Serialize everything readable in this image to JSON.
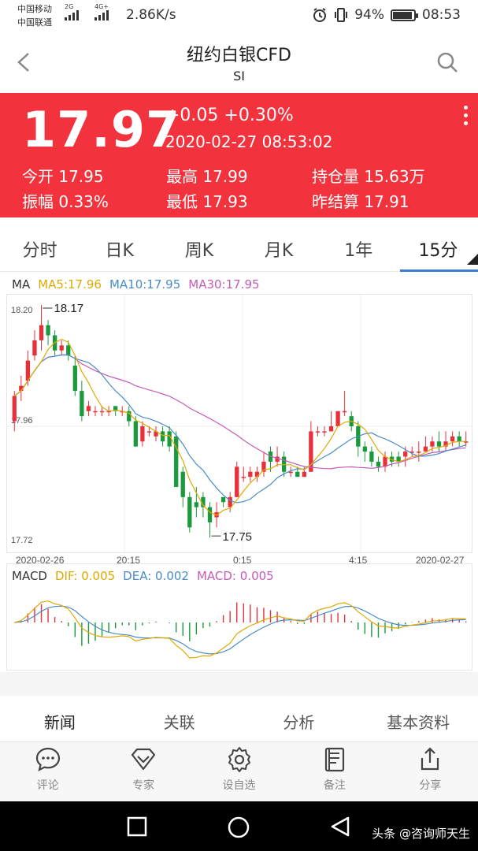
{
  "status_bar": {
    "carrier1": "中国移动",
    "carrier2": "中国联通",
    "net1": "2G",
    "net2": "4G+",
    "speed": "2.86K/s",
    "battery": "94%",
    "battery_level": 0.94,
    "time": "08:53"
  },
  "header": {
    "title": "纽约白银CFD",
    "subtitle": "SI"
  },
  "quote": {
    "price": "17.97",
    "change": "+0.05  +0.30%",
    "datetime": "2020-02-27  08:53:02",
    "rows": [
      [
        "今开 17.95",
        "最高 17.99",
        "持仓量 15.63万"
      ],
      [
        "振幅 0.33%",
        "最低 17.93",
        "昨结算 17.91"
      ]
    ],
    "colors": {
      "background": "#f2333d",
      "text": "#ffffff"
    }
  },
  "tabs": [
    {
      "label": "分时",
      "active": false
    },
    {
      "label": "日K",
      "active": false
    },
    {
      "label": "周K",
      "active": false
    },
    {
      "label": "月K",
      "active": false
    },
    {
      "label": "1年",
      "active": false
    },
    {
      "label": "15分",
      "active": true
    }
  ],
  "chart_data": {
    "type": "candlestick",
    "ma_legend": {
      "label": "MA",
      "ma5": "MA5:17.96",
      "ma10": "MA10:17.95",
      "ma30": "MA30:17.95"
    },
    "y_ticks": [
      "18.20",
      "17.96",
      "17.72"
    ],
    "ylim": [
      17.72,
      18.2
    ],
    "max_label": "18.17",
    "min_label": "17.75",
    "x_ticks": [
      "2020-02-26",
      "20:15",
      "0:15",
      "4:15",
      "2020-02-27"
    ],
    "colors": {
      "up": "#e8303a",
      "down": "#1a9a3c",
      "ma5": "#e0a800",
      "ma10": "#4a8cc8",
      "ma30": "#c45bb8"
    },
    "candles": [
      [
        17.97,
        18.02,
        18.03,
        17.95
      ],
      [
        18.03,
        18.04,
        18.06,
        18.01
      ],
      [
        18.05,
        18.09,
        18.11,
        18.04
      ],
      [
        18.1,
        18.13,
        18.15,
        18.09
      ],
      [
        18.13,
        18.16,
        18.2,
        18.11
      ],
      [
        18.16,
        18.14,
        18.17,
        18.12
      ],
      [
        18.14,
        18.11,
        18.15,
        18.1
      ],
      [
        18.11,
        18.12,
        18.13,
        18.1
      ],
      [
        18.12,
        18.1,
        18.13,
        18.09
      ],
      [
        18.08,
        18.03,
        18.1,
        18.02
      ],
      [
        18.03,
        17.98,
        18.05,
        17.97
      ],
      [
        17.99,
        18.0,
        18.01,
        17.98
      ],
      [
        17.99,
        17.99,
        18.0,
        17.98
      ],
      [
        17.99,
        17.99,
        18.0,
        17.98
      ],
      [
        17.99,
        17.99,
        18.0,
        17.98
      ],
      [
        18.0,
        17.99,
        18.0,
        17.98
      ],
      [
        17.99,
        17.99,
        18.0,
        17.98
      ],
      [
        17.99,
        17.97,
        18.0,
        17.96
      ],
      [
        17.97,
        17.92,
        17.98,
        17.92
      ],
      [
        17.93,
        17.96,
        17.97,
        17.92
      ],
      [
        17.95,
        17.95,
        17.96,
        17.94
      ],
      [
        17.94,
        17.95,
        17.96,
        17.93
      ],
      [
        17.95,
        17.93,
        17.96,
        17.92
      ],
      [
        17.95,
        17.92,
        17.96,
        17.91
      ],
      [
        17.94,
        17.84,
        17.95,
        17.84
      ],
      [
        17.87,
        17.82,
        17.88,
        17.8
      ],
      [
        17.82,
        17.76,
        17.83,
        17.75
      ],
      [
        17.81,
        17.8,
        17.84,
        17.78
      ],
      [
        17.82,
        17.8,
        17.83,
        17.78
      ],
      [
        17.8,
        17.77,
        17.81,
        17.74
      ],
      [
        17.78,
        17.79,
        17.81,
        17.76
      ],
      [
        17.82,
        17.81,
        17.82,
        17.8
      ],
      [
        17.8,
        17.82,
        17.83,
        17.79
      ],
      [
        17.82,
        17.88,
        17.89,
        17.82
      ],
      [
        17.86,
        17.86,
        17.88,
        17.85
      ],
      [
        17.86,
        17.87,
        17.88,
        17.85
      ],
      [
        17.86,
        17.87,
        17.88,
        17.85
      ],
      [
        17.87,
        17.89,
        17.91,
        17.86
      ],
      [
        17.91,
        17.89,
        17.92,
        17.87
      ],
      [
        17.89,
        17.9,
        17.92,
        17.88
      ],
      [
        17.9,
        17.87,
        17.91,
        17.86
      ],
      [
        17.87,
        17.87,
        17.88,
        17.86
      ],
      [
        17.87,
        17.86,
        17.88,
        17.86
      ],
      [
        17.86,
        17.87,
        17.88,
        17.86
      ],
      [
        17.87,
        17.95,
        17.97,
        17.87
      ],
      [
        17.95,
        17.95,
        17.96,
        17.94
      ],
      [
        17.95,
        17.95,
        17.96,
        17.94
      ],
      [
        17.95,
        17.96,
        17.99,
        17.95
      ],
      [
        17.96,
        17.99,
        17.99,
        17.96
      ],
      [
        17.99,
        17.99,
        18.03,
        17.98
      ],
      [
        17.98,
        17.96,
        17.99,
        17.95
      ],
      [
        17.96,
        17.92,
        17.97,
        17.9
      ],
      [
        17.92,
        17.91,
        17.93,
        17.89
      ],
      [
        17.91,
        17.89,
        17.92,
        17.88
      ],
      [
        17.89,
        17.88,
        17.9,
        17.87
      ],
      [
        17.88,
        17.9,
        17.91,
        17.87
      ],
      [
        17.9,
        17.89,
        17.91,
        17.88
      ],
      [
        17.9,
        17.89,
        17.91,
        17.88
      ],
      [
        17.9,
        17.91,
        17.92,
        17.88
      ],
      [
        17.91,
        17.91,
        17.92,
        17.9
      ],
      [
        17.91,
        17.91,
        17.93,
        17.89
      ],
      [
        17.91,
        17.92,
        17.94,
        17.91
      ],
      [
        17.92,
        17.93,
        17.94,
        17.91
      ],
      [
        17.93,
        17.92,
        17.95,
        17.91
      ],
      [
        17.92,
        17.93,
        17.95,
        17.91
      ],
      [
        17.93,
        17.94,
        17.95,
        17.92
      ],
      [
        17.94,
        17.93,
        17.95,
        17.92
      ],
      [
        17.93,
        17.93,
        17.95,
        17.92
      ]
    ],
    "macd_legend": {
      "label": "MACD",
      "dif": "DIF: 0.005",
      "dea": "DEA: 0.002",
      "macd": "MACD: 0.005"
    },
    "macd_colors": {
      "dif": "#e0a800",
      "dea": "#4a8cc8",
      "macd": "#c45bb8"
    }
  },
  "content_tabs": [
    {
      "label": "新闻",
      "active": true
    },
    {
      "label": "关联",
      "active": false
    },
    {
      "label": "分析",
      "active": false
    },
    {
      "label": "基本资料",
      "active": false
    }
  ],
  "actions": [
    {
      "label": "评论",
      "icon": "comment-icon"
    },
    {
      "label": "专家",
      "icon": "diamond-icon"
    },
    {
      "label": "设自选",
      "icon": "gear-icon"
    },
    {
      "label": "备注",
      "icon": "note-icon"
    },
    {
      "label": "分享",
      "icon": "share-icon"
    }
  ],
  "watermark": "头条 @咨询师天生"
}
